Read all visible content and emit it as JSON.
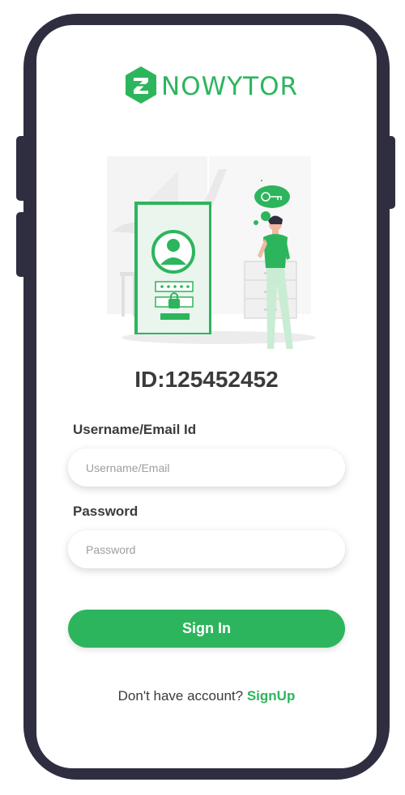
{
  "brand": {
    "name": "NOWYTOR",
    "logo_icon": "z-hexagon-icon",
    "color": "#2db55d"
  },
  "account": {
    "id_label": "ID:125452452"
  },
  "form": {
    "username_label": "Username/Email Id",
    "username_placeholder": "Username/Email",
    "password_label": "Password",
    "password_placeholder": "Password",
    "signin_label": "Sign In"
  },
  "footer": {
    "prompt": "Don't have account?",
    "signup_label": "SignUp"
  },
  "colors": {
    "accent": "#2db55d",
    "frame": "#2f2e41",
    "text": "#3b3b3b"
  },
  "icons": [
    "z-hexagon-icon",
    "login-illustration",
    "user-avatar-icon",
    "lock-icon",
    "key-thought-bubble-icon"
  ]
}
